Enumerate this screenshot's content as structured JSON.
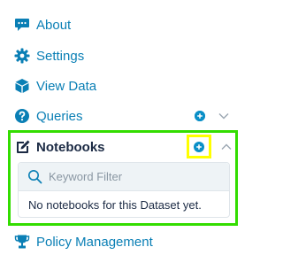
{
  "nav": {
    "about": {
      "label": "About",
      "icon": "chat-bubble-icon"
    },
    "settings": {
      "label": "Settings",
      "icon": "gear-icon"
    },
    "view_data": {
      "label": "View Data",
      "icon": "cube-icon"
    },
    "queries": {
      "label": "Queries",
      "icon": "question-circle-icon",
      "add_icon": "plus-circle-icon",
      "toggle_icon": "chevron-down-icon"
    },
    "notebooks": {
      "label": "Notebooks",
      "icon": "edit-icon",
      "add_icon": "plus-circle-icon",
      "toggle_icon": "chevron-up-icon",
      "filter": {
        "placeholder": "Keyword Filter",
        "value": ""
      },
      "empty_message": "No notebooks for this Dataset yet."
    },
    "policy": {
      "label": "Policy Management",
      "icon": "trophy-icon"
    }
  },
  "colors": {
    "link": "#0a7fb5",
    "heading": "#1b2a44",
    "accent": "#0a8fc7",
    "highlight_green": "#33dd00",
    "highlight_yellow": "#ffff00"
  }
}
